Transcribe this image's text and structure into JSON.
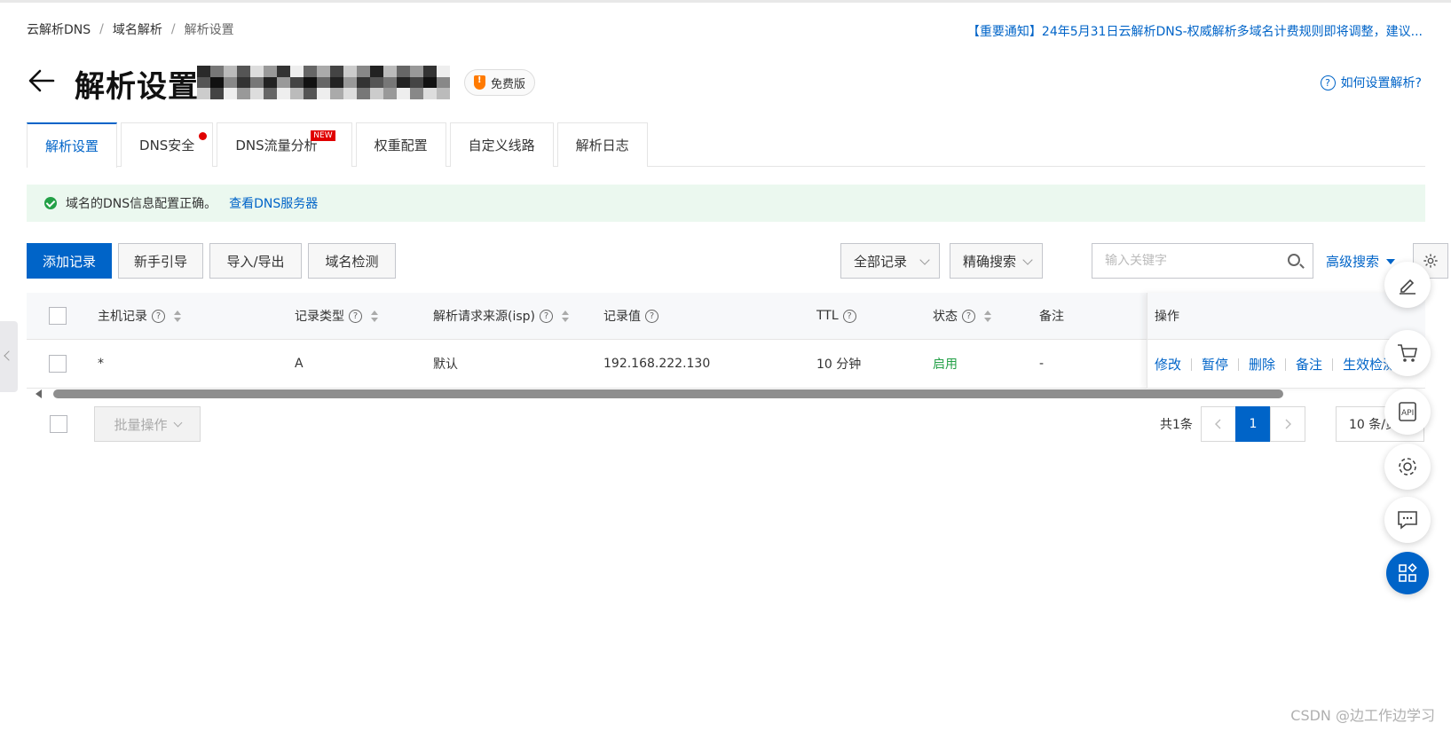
{
  "breadcrumb": {
    "items": [
      "云解析DNS",
      "域名解析",
      "解析设置"
    ],
    "separator": "/"
  },
  "notice": "【重要通知】24年5月31日云解析DNS-权威解析多域名计费规则即将调整，建议...",
  "header": {
    "title": "解析设置",
    "edition_badge": "免费版",
    "help_link": "如何设置解析?"
  },
  "tabs": [
    {
      "label": "解析设置",
      "active": true
    },
    {
      "label": "DNS安全",
      "dot": true
    },
    {
      "label": "DNS流量分析",
      "tag": "NEW"
    },
    {
      "label": "权重配置"
    },
    {
      "label": "自定义线路"
    },
    {
      "label": "解析日志"
    }
  ],
  "alert": {
    "text": "域名的DNS信息配置正确。",
    "link": "查看DNS服务器"
  },
  "toolbar": {
    "add_record": "添加记录",
    "newbie_guide": "新手引导",
    "import_export": "导入/导出",
    "domain_check": "域名检测",
    "record_filter": "全部记录",
    "search_mode": "精确搜索",
    "search_placeholder": "输入关键字",
    "advanced_search": "高级搜索"
  },
  "table": {
    "columns": {
      "host": "主机记录",
      "type": "记录类型",
      "isp": "解析请求来源(isp)",
      "value": "记录值",
      "ttl": "TTL",
      "status": "状态",
      "remark": "备注",
      "actions": "操作"
    },
    "rows": [
      {
        "host": "*",
        "type": "A",
        "isp": "默认",
        "value": "192.168.222.130",
        "ttl": "10 分钟",
        "status": "启用",
        "remark": "-",
        "actions": [
          "修改",
          "暂停",
          "删除",
          "备注",
          "生效检测"
        ]
      }
    ]
  },
  "footer": {
    "batch_ops": "批量操作",
    "total": "共1条",
    "current_page": "1",
    "page_size": "10 条/页"
  },
  "watermark": "CSDN @边工作边学习",
  "colors": {
    "primary": "#0064c8",
    "success": "#23a047",
    "alert_bg": "#ebf8ef",
    "danger": "#e00000"
  }
}
